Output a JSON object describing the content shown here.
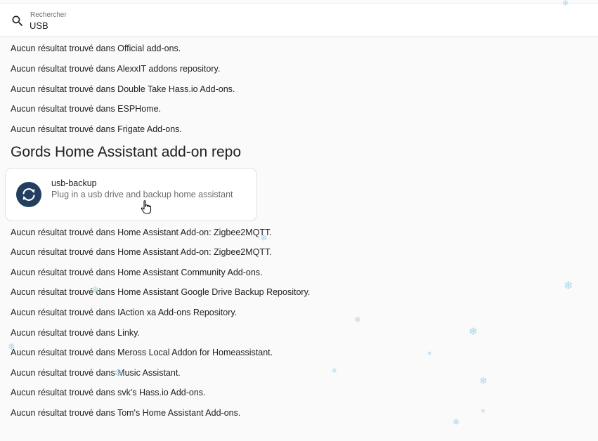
{
  "search": {
    "label": "Rechercher",
    "value": "USB"
  },
  "results_before": [
    "Aucun résultat trouvé dans Official add-ons.",
    "Aucun résultat trouvé dans AlexxIT addons repository.",
    "Aucun résultat trouvé dans Double Take Hass.io Add-ons.",
    "Aucun résultat trouvé dans ESPHome.",
    "Aucun résultat trouvé dans Frigate Add-ons."
  ],
  "repository": {
    "title": "Gords Home Assistant add-on repo",
    "addon": {
      "name": "usb-backup",
      "description": "Plug in a usb drive and backup home assistant",
      "icon": "backup-sync-icon",
      "icon_color": "#233e5f"
    }
  },
  "results_after": [
    "Aucun résultat trouvé dans Home Assistant Add-on: Zigbee2MQTT.",
    "Aucun résultat trouvé dans Home Assistant Add-on: Zigbee2MQTT.",
    "Aucun résultat trouvé dans Home Assistant Community Add-ons.",
    "Aucun résultat trouvé dans Home Assistant Google Drive Backup Repository.",
    "Aucun résultat trouvé dans IAction xa Add-ons Repository.",
    "Aucun résultat trouvé dans Linky.",
    "Aucun résultat trouvé dans Meross Local Addon for Homeassistant.",
    "Aucun résultat trouvé dans Music Assistant.",
    "Aucun résultat trouvé dans svk's Hass.io Add-ons.",
    "Aucun résultat trouvé dans Tom's Home Assistant Add-ons."
  ],
  "decor": {
    "snowflake_glyph": "❄",
    "snowflake_color": "#a9d8ea"
  }
}
